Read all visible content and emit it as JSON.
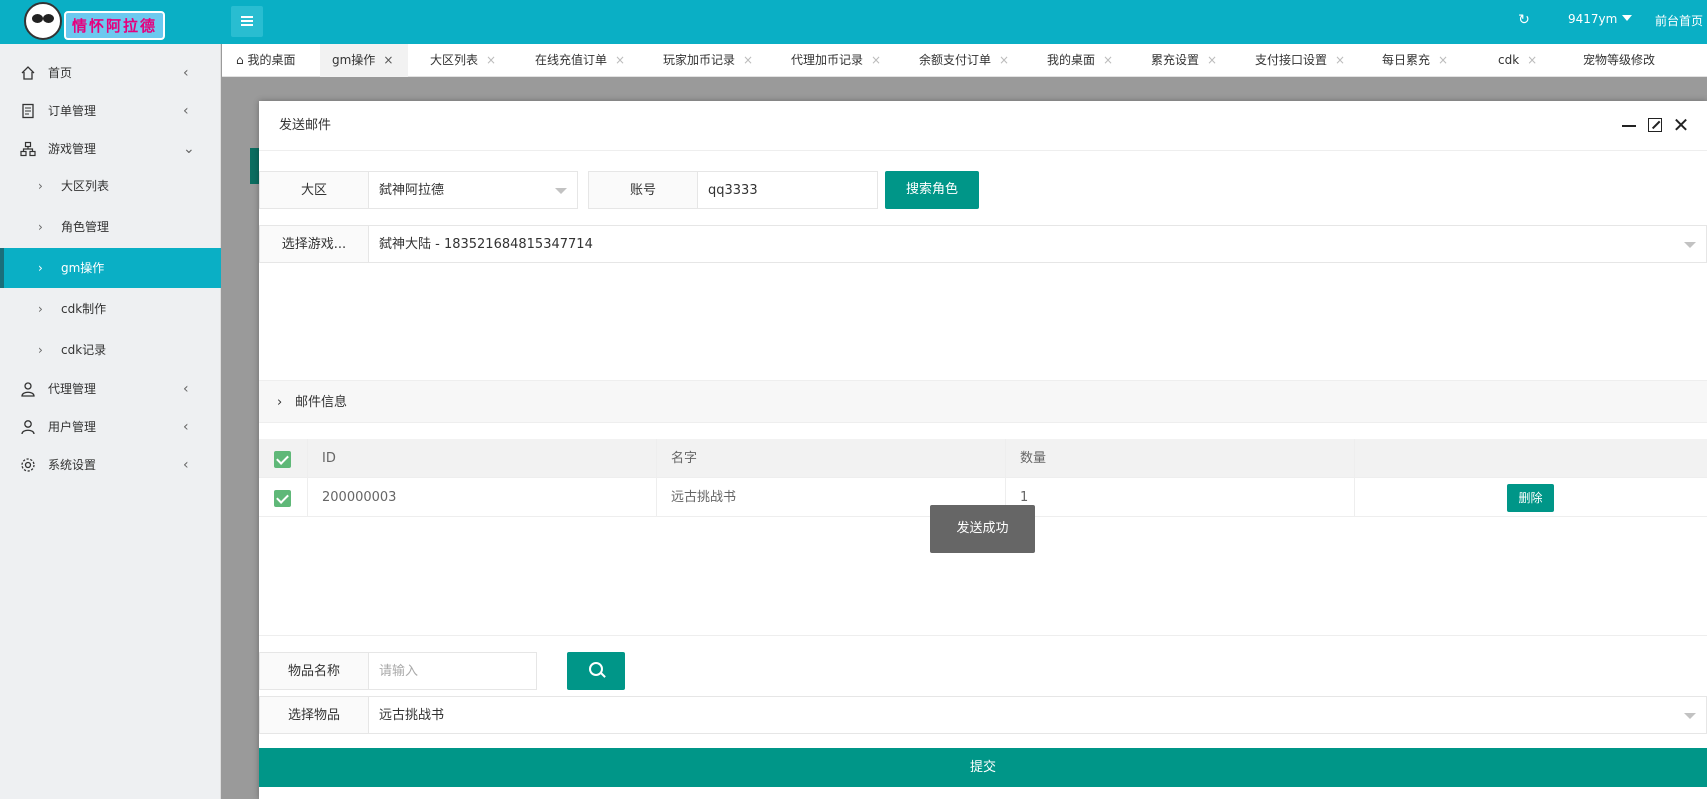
{
  "header": {
    "logo_text": "情怀阿拉德",
    "user_name": "9417ym",
    "front_link": "前台首页",
    "refresh_icon": "refresh-icon",
    "menu_icon": "hamburger-icon"
  },
  "sidebar": {
    "items": [
      {
        "label": "首页",
        "icon": "home-icon",
        "chev": "‹"
      },
      {
        "label": "订单管理",
        "icon": "order-icon",
        "chev": "‹"
      },
      {
        "label": "游戏管理",
        "icon": "sitemap-icon",
        "chev": "⌄"
      },
      {
        "label": "代理管理",
        "icon": "agent-icon",
        "chev": "‹"
      },
      {
        "label": "用户管理",
        "icon": "user-icon",
        "chev": "‹"
      },
      {
        "label": "系统设置",
        "icon": "gear-icon",
        "chev": "‹"
      }
    ],
    "sub_items": [
      {
        "label": "大区列表"
      },
      {
        "label": "角色管理"
      },
      {
        "label": "gm操作"
      },
      {
        "label": "cdk制作"
      },
      {
        "label": "cdk记录"
      }
    ]
  },
  "tabs": [
    {
      "label": "我的桌面"
    },
    {
      "label": "gm操作"
    },
    {
      "label": "大区列表"
    },
    {
      "label": "在线充值订单"
    },
    {
      "label": "玩家加币记录"
    },
    {
      "label": "代理加币记录"
    },
    {
      "label": "余额支付订单"
    },
    {
      "label": "我的桌面"
    },
    {
      "label": "累充设置"
    },
    {
      "label": "支付接口设置"
    },
    {
      "label": "每日累充"
    },
    {
      "label": "cdk"
    },
    {
      "label": "宠物等级修改"
    }
  ],
  "tab_close": "×",
  "modal": {
    "title": "发送邮件",
    "region_label": "大区",
    "region_value": "弑神阿拉德",
    "account_label": "账号",
    "account_value": "qq3333",
    "search_role_button": "搜索角色",
    "game_role_label": "选择游戏...",
    "game_role_value": "弑神大陆 - 183521684815347714",
    "mail_info_label": "邮件信息",
    "table": {
      "headers": [
        "ID",
        "名字",
        "数量"
      ],
      "rows": [
        {
          "id": "200000003",
          "name": "远古挑战书",
          "qty": "1",
          "delete_label": "删除"
        }
      ]
    },
    "toast": "发送成功",
    "item_name_label": "物品名称",
    "item_name_placeholder": "请输入",
    "select_item_label": "选择物品",
    "select_item_value": "远古挑战书",
    "submit_label": "提交",
    "close_symbol": "✕"
  }
}
